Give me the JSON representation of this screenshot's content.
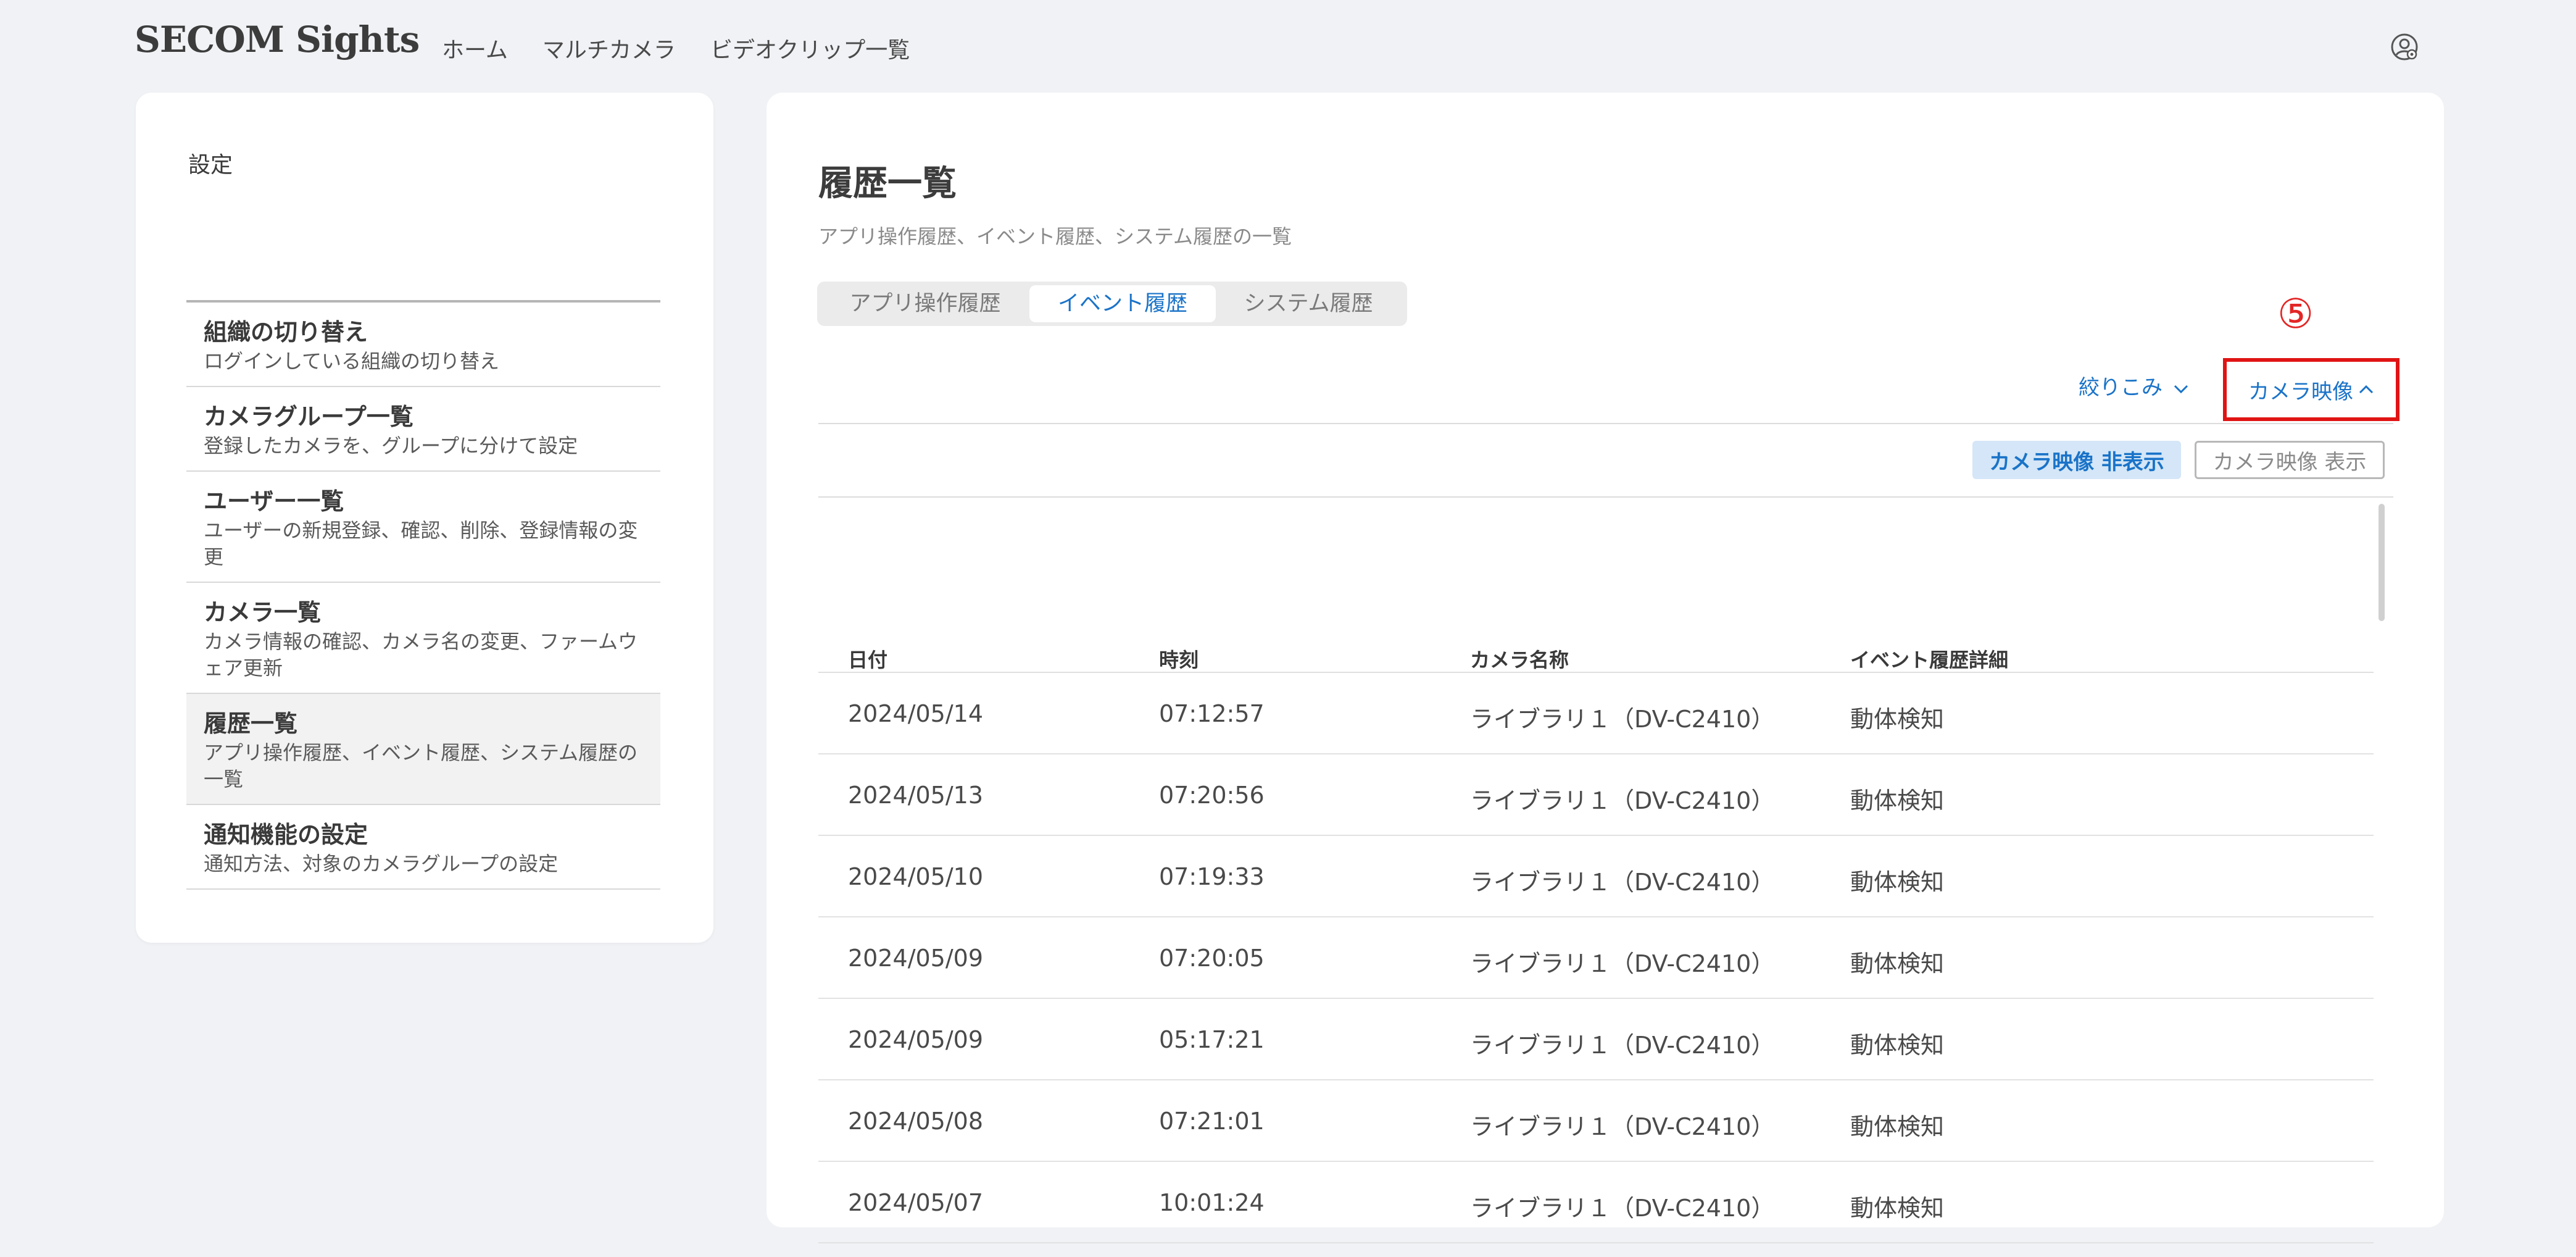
{
  "app": {
    "logo": "SECOM Sights"
  },
  "nav": {
    "items": [
      "ホーム",
      "マルチカメラ",
      "ビデオクリップ一覧"
    ]
  },
  "sidebar": {
    "title": "設定",
    "items": [
      {
        "title": "組織の切り替え",
        "desc": "ログインしている組織の切り替え"
      },
      {
        "title": "カメラグループ一覧",
        "desc": "登録したカメラを、グループに分けて設定"
      },
      {
        "title": "ユーザー一覧",
        "desc": "ユーザーの新規登録、確認、削除、登録情報の変更"
      },
      {
        "title": "カメラ一覧",
        "desc": "カメラ情報の確認、カメラ名の変更、ファームウェア更新"
      },
      {
        "title": "履歴一覧",
        "desc": "アプリ操作履歴、イベント履歴、システム履歴の一覧"
      },
      {
        "title": "通知機能の設定",
        "desc": "通知方法、対象のカメラグループの設定"
      }
    ]
  },
  "main": {
    "title": "履歴一覧",
    "subtitle": "アプリ操作履歴、イベント履歴、システム履歴の一覧",
    "tabs": [
      "アプリ操作履歴",
      "イベント履歴",
      "システム履歴"
    ],
    "annotation": "⑤",
    "filter_label": "絞りこみ",
    "camera_label": "カメラ映像",
    "hide_button": "カメラ映像 非表示",
    "show_button": "カメラ映像 表示"
  },
  "table": {
    "headers": [
      "日付",
      "時刻",
      "カメラ名称",
      "イベント履歴詳細"
    ],
    "rows": [
      [
        "2024/05/14",
        "07:12:57",
        "ライブラリ１（DV-C2410）",
        "動体検知"
      ],
      [
        "2024/05/13",
        "07:20:56",
        "ライブラリ１（DV-C2410）",
        "動体検知"
      ],
      [
        "2024/05/10",
        "07:19:33",
        "ライブラリ１（DV-C2410）",
        "動体検知"
      ],
      [
        "2024/05/09",
        "07:20:05",
        "ライブラリ１（DV-C2410）",
        "動体検知"
      ],
      [
        "2024/05/09",
        "05:17:21",
        "ライブラリ１（DV-C2410）",
        "動体検知"
      ],
      [
        "2024/05/08",
        "07:21:01",
        "ライブラリ１（DV-C2410）",
        "動体検知"
      ],
      [
        "2024/05/07",
        "10:01:24",
        "ライブラリ１（DV-C2410）",
        "動体検知"
      ]
    ]
  },
  "colors": {
    "accent": "#1a73c8",
    "highlight_box": "#e01414",
    "background": "#f0f2f5"
  },
  "icons": {
    "user": "user-settings-icon",
    "filter_chevron": "chevron-down-icon",
    "camera_chevron": "chevron-up-icon"
  }
}
